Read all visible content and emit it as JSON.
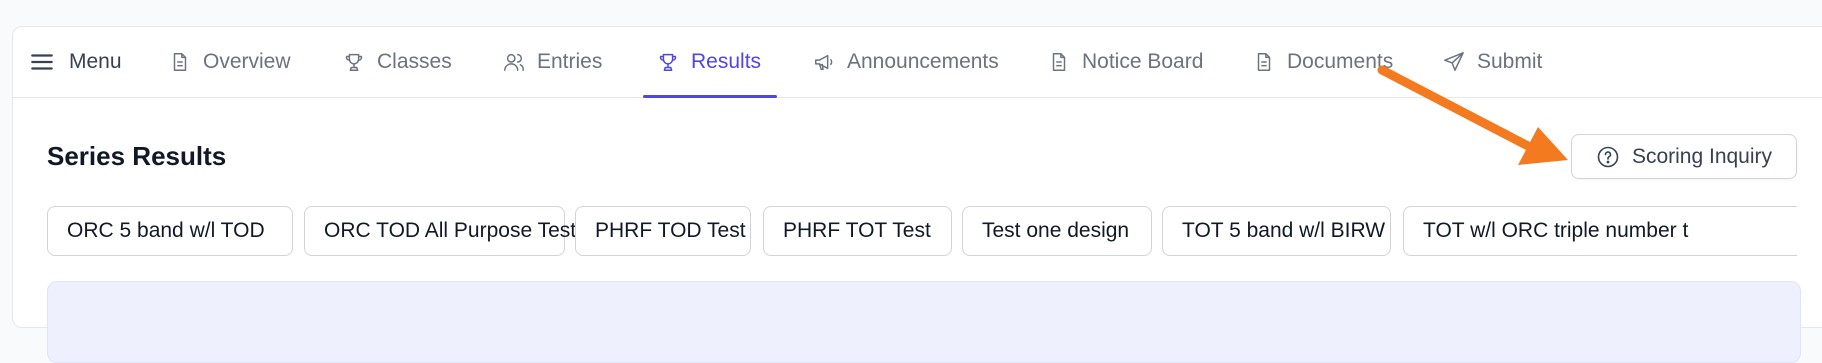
{
  "nav": {
    "menu_label": "Menu",
    "items": [
      {
        "label": "Overview",
        "icon": "document-icon"
      },
      {
        "label": "Classes",
        "icon": "trophy-icon"
      },
      {
        "label": "Entries",
        "icon": "users-icon"
      },
      {
        "label": "Results",
        "icon": "trophy-icon",
        "active": true
      },
      {
        "label": "Announcements",
        "icon": "megaphone-icon"
      },
      {
        "label": "Notice Board",
        "icon": "document-icon"
      },
      {
        "label": "Documents",
        "icon": "document-icon"
      },
      {
        "label": "Submit",
        "icon": "send-icon"
      }
    ]
  },
  "section": {
    "title": "Series Results",
    "inquiry_label": "Scoring Inquiry"
  },
  "chips": [
    "ORC 5 band w/l TOD",
    "ORC TOD All Purpose Test",
    "PHRF TOD Test",
    "PHRF TOT Test",
    "Test one design",
    "TOT 5 band w/l BIRW",
    "TOT w/l ORC triple number t"
  ],
  "colors": {
    "accent": "#4f46e5",
    "annotation_arrow": "#f47a1f",
    "panel_bg": "#eef0fd"
  }
}
